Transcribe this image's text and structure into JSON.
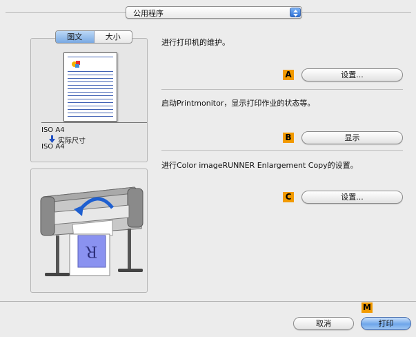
{
  "header": {
    "popup_label": "公用程序"
  },
  "preview": {
    "tabs": [
      "图文",
      "大小"
    ],
    "active_tab": 0,
    "paper_line1": "ISO A4",
    "scale_label": "实际尺寸",
    "paper_line2": "ISO A4"
  },
  "utilities": [
    {
      "description": "进行打印机的维护。",
      "badge": "A",
      "button_label": "设置..."
    },
    {
      "description": "启动Printmonitor，显示打印作业的状态等。",
      "badge": "B",
      "button_label": "显示"
    },
    {
      "description": "进行Color imageRUNNER Enlargement Copy的设置。",
      "badge": "C",
      "button_label": "设置..."
    }
  ],
  "footer": {
    "badge": "M",
    "cancel_label": "取消",
    "print_label": "打印"
  },
  "colors": {
    "badge": "#f29a00",
    "accent_blue": "#6fa6ea"
  }
}
